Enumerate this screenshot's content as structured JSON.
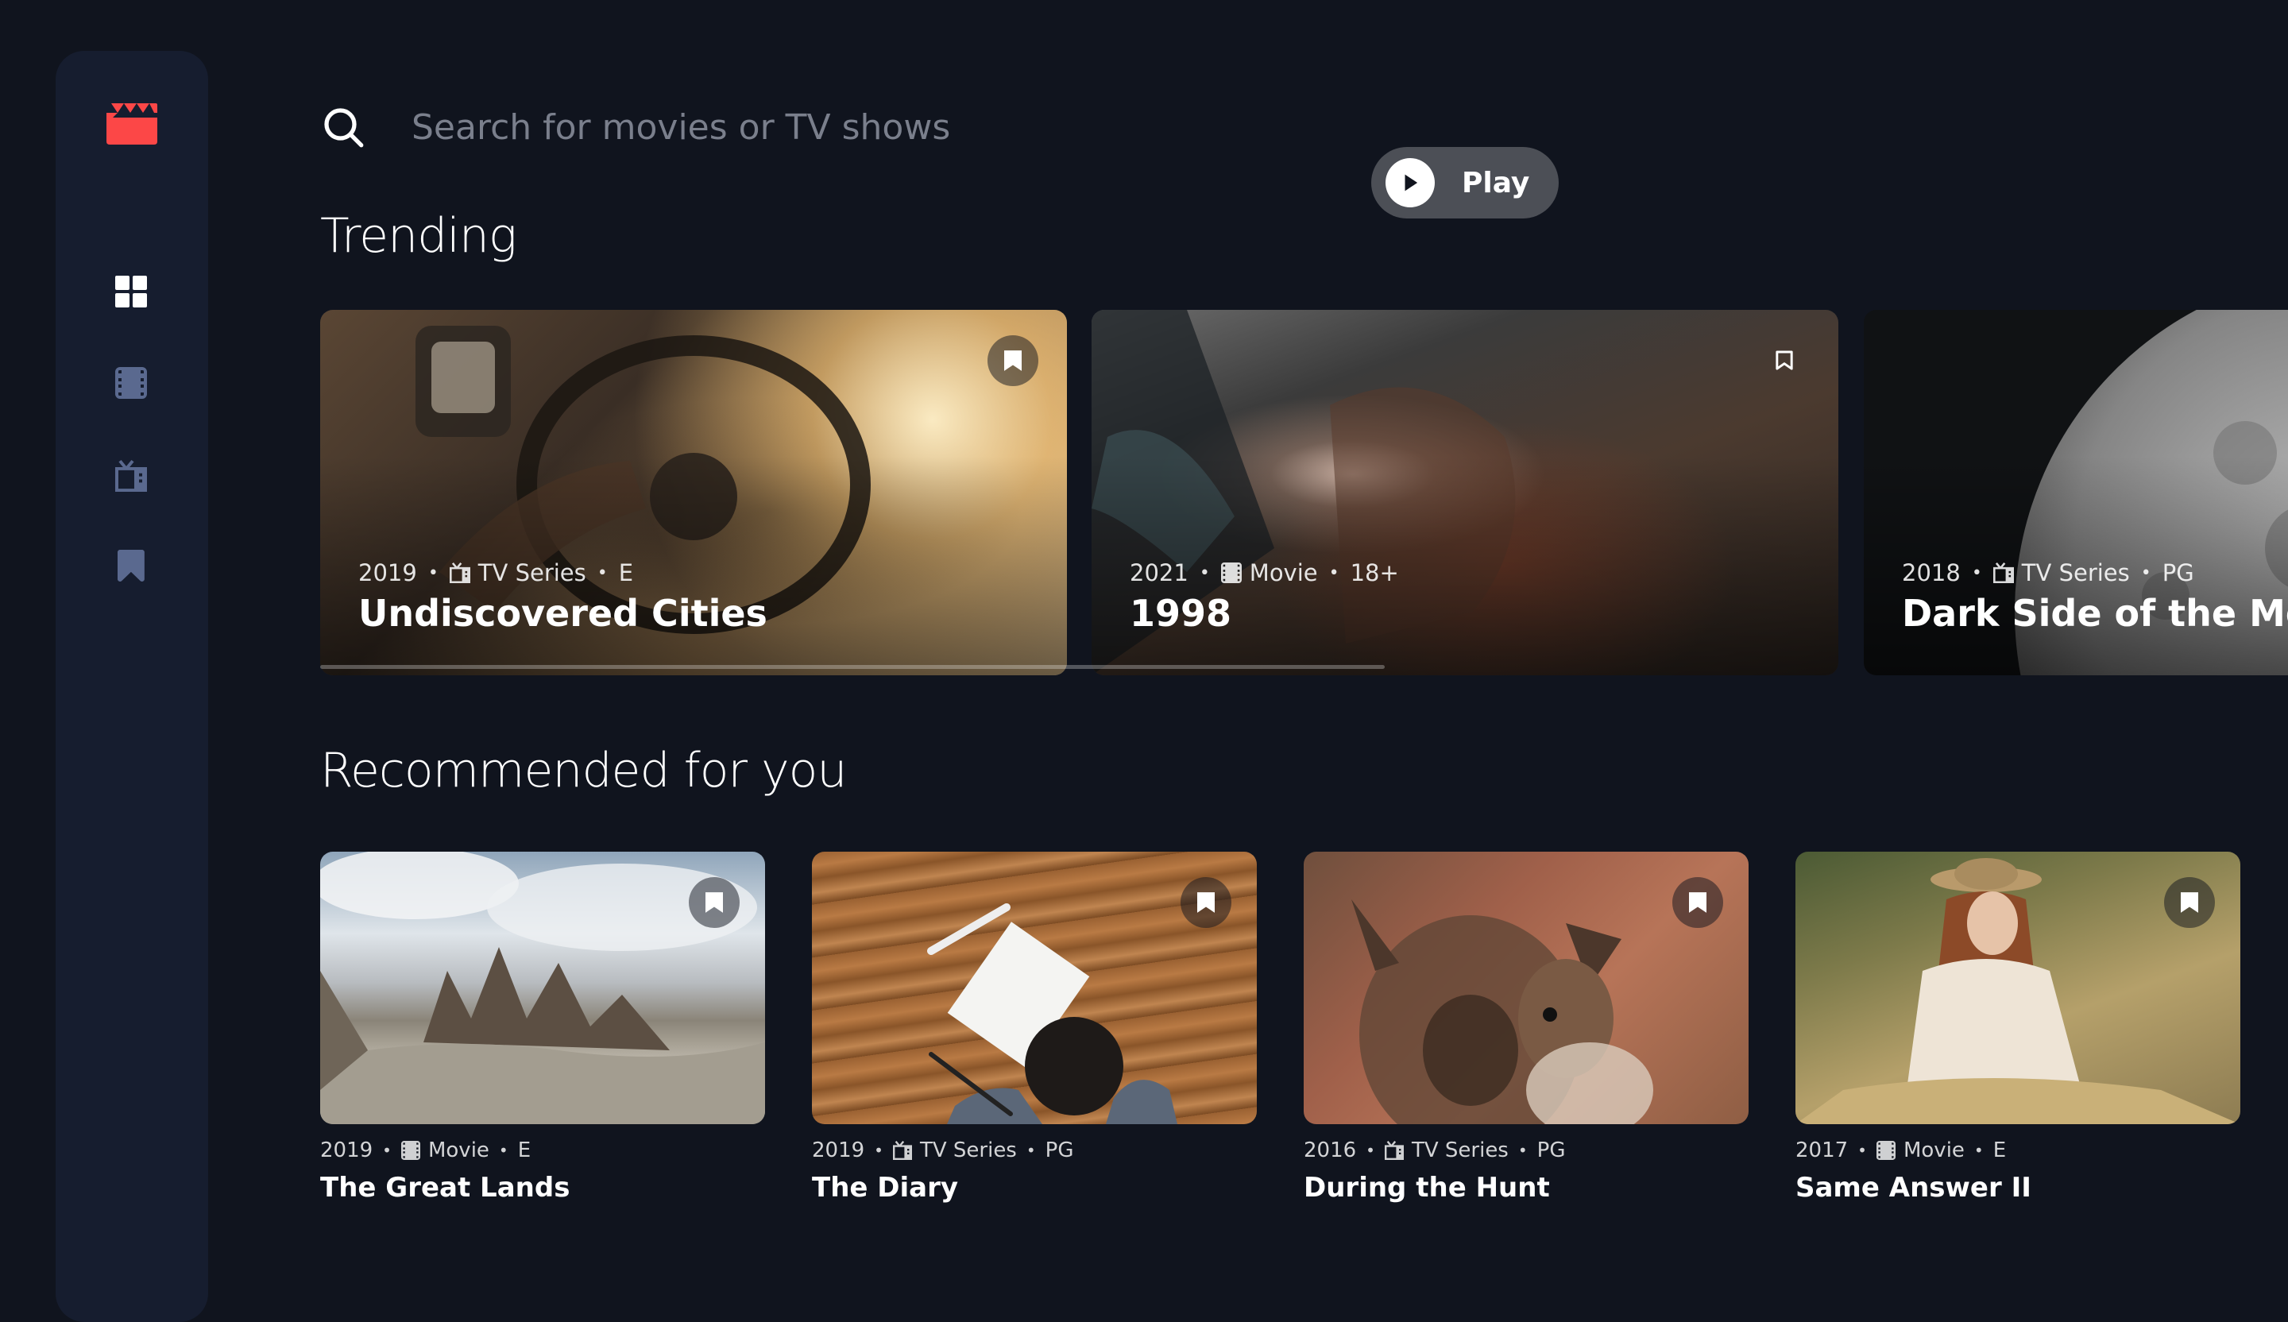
{
  "brand": {
    "logo_icon": "clapperboard-icon",
    "accent": "#fc4747"
  },
  "nav": [
    {
      "name": "home",
      "icon": "grid-icon",
      "active": true
    },
    {
      "name": "movies",
      "icon": "film-icon",
      "active": false
    },
    {
      "name": "tv-series",
      "icon": "tv-icon",
      "active": false
    },
    {
      "name": "bookmarks",
      "icon": "bookmark-icon",
      "active": false
    }
  ],
  "search": {
    "placeholder": "Search for movies or TV shows",
    "value": ""
  },
  "sections": {
    "trending": "Trending",
    "recommended": "Recommended for you"
  },
  "trending": [
    {
      "year": "2019",
      "category": "TV Series",
      "category_icon": "tv-icon",
      "rating": "E",
      "title": "Undiscovered Cities",
      "bookmarked": true
    },
    {
      "year": "2021",
      "category": "Movie",
      "category_icon": "film-icon",
      "rating": "18+",
      "title": "1998",
      "bookmarked": false,
      "play_label": "Play"
    },
    {
      "year": "2018",
      "category": "TV Series",
      "category_icon": "tv-icon",
      "rating": "PG",
      "title": "Dark Side of the Moon",
      "bookmarked": false
    }
  ],
  "recommended": [
    {
      "year": "2019",
      "category": "Movie",
      "category_icon": "film-icon",
      "rating": "E",
      "title": "The Great Lands",
      "bookmarked": true
    },
    {
      "year": "2019",
      "category": "TV Series",
      "category_icon": "tv-icon",
      "rating": "PG",
      "title": "The Diary",
      "bookmarked": true
    },
    {
      "year": "2016",
      "category": "TV Series",
      "category_icon": "tv-icon",
      "rating": "PG",
      "title": "During the Hunt",
      "bookmarked": true
    },
    {
      "year": "2017",
      "category": "Movie",
      "category_icon": "film-icon",
      "rating": "E",
      "title": "Same Answer II",
      "bookmarked": true
    }
  ]
}
